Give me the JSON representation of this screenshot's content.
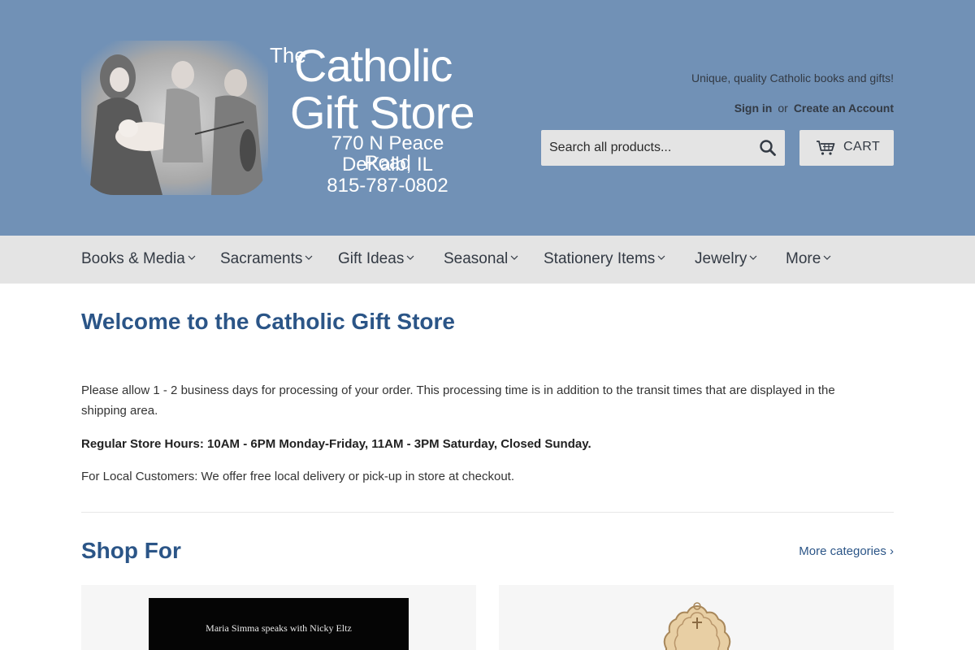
{
  "logo": {
    "line_the": "The",
    "line_catholic": "Catholic",
    "line_gift": "Gift Store",
    "address": "770 N Peace Road",
    "city": "DeKalb, IL",
    "phone": "815-787-0802"
  },
  "header": {
    "tagline": "Unique, quality Catholic books and gifts!",
    "sign_in": "Sign in",
    "or": "or",
    "create_account": "Create an Account",
    "search_placeholder": "Search all products...",
    "cart_label": "Cart",
    "icons": {
      "search": "search-icon",
      "cart": "cart-icon"
    }
  },
  "nav": {
    "items": [
      {
        "label": "Books & Media"
      },
      {
        "label": "Sacraments"
      },
      {
        "label": "Gift Ideas"
      },
      {
        "label": "Seasonal"
      },
      {
        "label": "Stationery Items"
      },
      {
        "label": "Jewelry"
      },
      {
        "label": "More"
      }
    ]
  },
  "main": {
    "title": "Welcome to the Catholic Gift Store",
    "paragraph_1": "Please allow 1 - 2 business days for processing of your order.  This processing time is in addition to the transit times that are displayed in the shipping area.",
    "paragraph_2": "Regular Store Hours:  10AM - 6PM Monday-Friday, 11AM - 3PM Saturday, Closed Sunday.",
    "paragraph_3": "For Local Customers: We offer free local delivery or pick-up in store at checkout."
  },
  "shop": {
    "title": "Shop For",
    "more_link": "More categories ›",
    "cards": [
      {
        "book_title": "Maria Simma speaks with Nicky Eltz"
      },
      {
        "image": "medal"
      }
    ]
  },
  "colors": {
    "header_bg": "#7191b6",
    "nav_bg": "#e4e4e4",
    "accent": "#2b5587"
  }
}
